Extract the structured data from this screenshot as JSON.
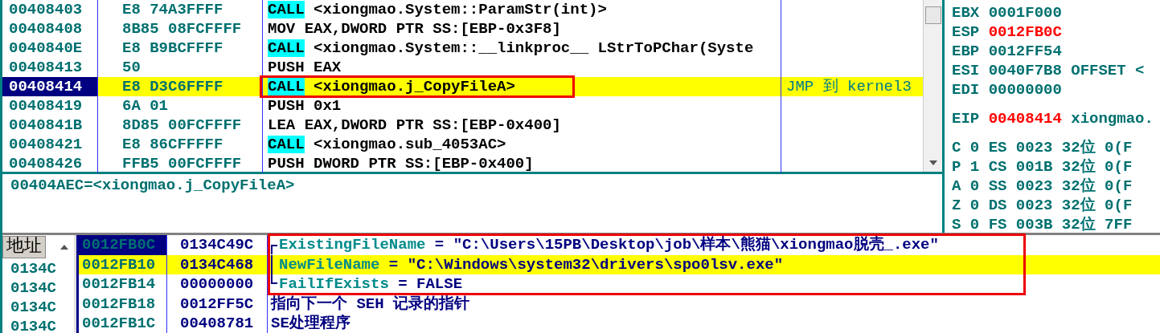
{
  "disassembly": {
    "rows": [
      {
        "address": "00408403",
        "hex": "E8 74A3FFFF",
        "kind": "call",
        "mnemonic": "CALL",
        "operands": "<xiongmao.System::ParamStr(int)>",
        "selected": false,
        "current": false,
        "boxed": false
      },
      {
        "address": "00408408",
        "hex": "8B85 08FCFFFF",
        "kind": "plain",
        "mnemonic": "MOV",
        "operands": "EAX,DWORD PTR SS:[EBP-0x3F8]",
        "selected": false,
        "current": false,
        "boxed": false
      },
      {
        "address": "0040840E",
        "hex": "E8 B9BCFFFF",
        "kind": "call",
        "mnemonic": "CALL",
        "operands": "<xiongmao.System::__linkproc__ LStrToPChar(Syste",
        "selected": false,
        "current": false,
        "boxed": false
      },
      {
        "address": "00408413",
        "hex": "50",
        "kind": "plain",
        "mnemonic": "PUSH",
        "operands": "EAX",
        "selected": false,
        "current": false,
        "boxed": false
      },
      {
        "address": "00408414",
        "hex": "E8 D3C6FFFF",
        "kind": "call",
        "mnemonic": "CALL",
        "operands": "<xiongmao.j_CopyFileA>",
        "comment": "JMP 到 kernel3",
        "selected": true,
        "current": true,
        "boxed": true
      },
      {
        "address": "00408419",
        "hex": "6A 01",
        "kind": "plain",
        "mnemonic": "PUSH",
        "operands": "0x1",
        "selected": false,
        "current": false,
        "boxed": false
      },
      {
        "address": "0040841B",
        "hex": "8D85 00FCFFFF",
        "kind": "plain",
        "mnemonic": "LEA",
        "operands": "EAX,DWORD PTR SS:[EBP-0x400]",
        "selected": false,
        "current": false,
        "boxed": false
      },
      {
        "address": "00408421",
        "hex": "E8 86CFFFFF",
        "kind": "call",
        "mnemonic": "CALL",
        "operands": "<xiongmao.sub_4053AC>",
        "selected": false,
        "current": false,
        "boxed": false
      },
      {
        "address": "00408426",
        "hex": "FFB5 00FCFFFF",
        "kind": "plain",
        "mnemonic": "PUSH",
        "operands": "DWORD PTR SS:[EBP-0x400]",
        "selected": false,
        "current": false,
        "boxed": false
      }
    ]
  },
  "info": "00404AEC=<xiongmao.j_CopyFileA>",
  "registers": [
    {
      "name": "EBX",
      "value": "0001F000",
      "changed": false
    },
    {
      "name": "ESP",
      "value": "0012FB0C",
      "changed": true
    },
    {
      "name": "EBP",
      "value": "0012FF54",
      "changed": false
    },
    {
      "name": "ESI",
      "value": "0040F7B8",
      "changed": false,
      "note": "OFFSET <"
    },
    {
      "name": "EDI",
      "value": "00000000",
      "changed": false
    }
  ],
  "eip": {
    "name": "EIP",
    "value": "00408414",
    "changed": true,
    "note": "xiongmao."
  },
  "flags": [
    {
      "flag": "C",
      "bit": "0",
      "segment": "ES",
      "selector": "0023",
      "bits": "32位",
      "base": "0(F"
    },
    {
      "flag": "P",
      "bit": "1",
      "segment": "CS",
      "selector": "001B",
      "bits": "32位",
      "base": "0(F"
    },
    {
      "flag": "A",
      "bit": "0",
      "segment": "SS",
      "selector": "0023",
      "bits": "32位",
      "base": "0(F"
    },
    {
      "flag": "Z",
      "bit": "0",
      "segment": "DS",
      "selector": "0023",
      "bits": "32位",
      "base": "0(F"
    },
    {
      "flag": "S",
      "bit": "0",
      "segment": "FS",
      "selector": "003B",
      "bits": "32位",
      "base": "7FF"
    }
  ],
  "dump": {
    "header": "地址",
    "rows": [
      "0134C",
      "0134C",
      "0134C",
      "0134C"
    ]
  },
  "stack": {
    "rows": [
      {
        "address": "0012FB0C",
        "value": "0134C49C",
        "kind": "arg_first",
        "name": "ExistingFileName",
        "text": "= \"C:\\Users\\15PB\\Desktop\\job\\样本\\熊猫\\xiongmao脱壳_.exe\"",
        "selected": true,
        "current": false,
        "boxed": true
      },
      {
        "address": "0012FB10",
        "value": "0134C468",
        "kind": "arg",
        "name": "NewFileName",
        "text": "= \"C:\\Windows\\system32\\drivers\\spo0lsv.exe\"",
        "selected": false,
        "current": true,
        "boxed": true
      },
      {
        "address": "0012FB14",
        "value": "00000000",
        "kind": "arg_last",
        "name": "FailIfExists",
        "text": "= FALSE",
        "selected": false,
        "current": false,
        "boxed": true
      },
      {
        "address": "0012FB18",
        "value": "0012FF5C",
        "kind": "plain",
        "text": "指向下一个 SEH 记录的指针",
        "selected": false,
        "current": false,
        "boxed": false
      },
      {
        "address": "0012FB1C",
        "value": "00408781",
        "kind": "plain",
        "text": "SE处理程序",
        "selected": false,
        "current": false,
        "boxed": false
      }
    ]
  }
}
